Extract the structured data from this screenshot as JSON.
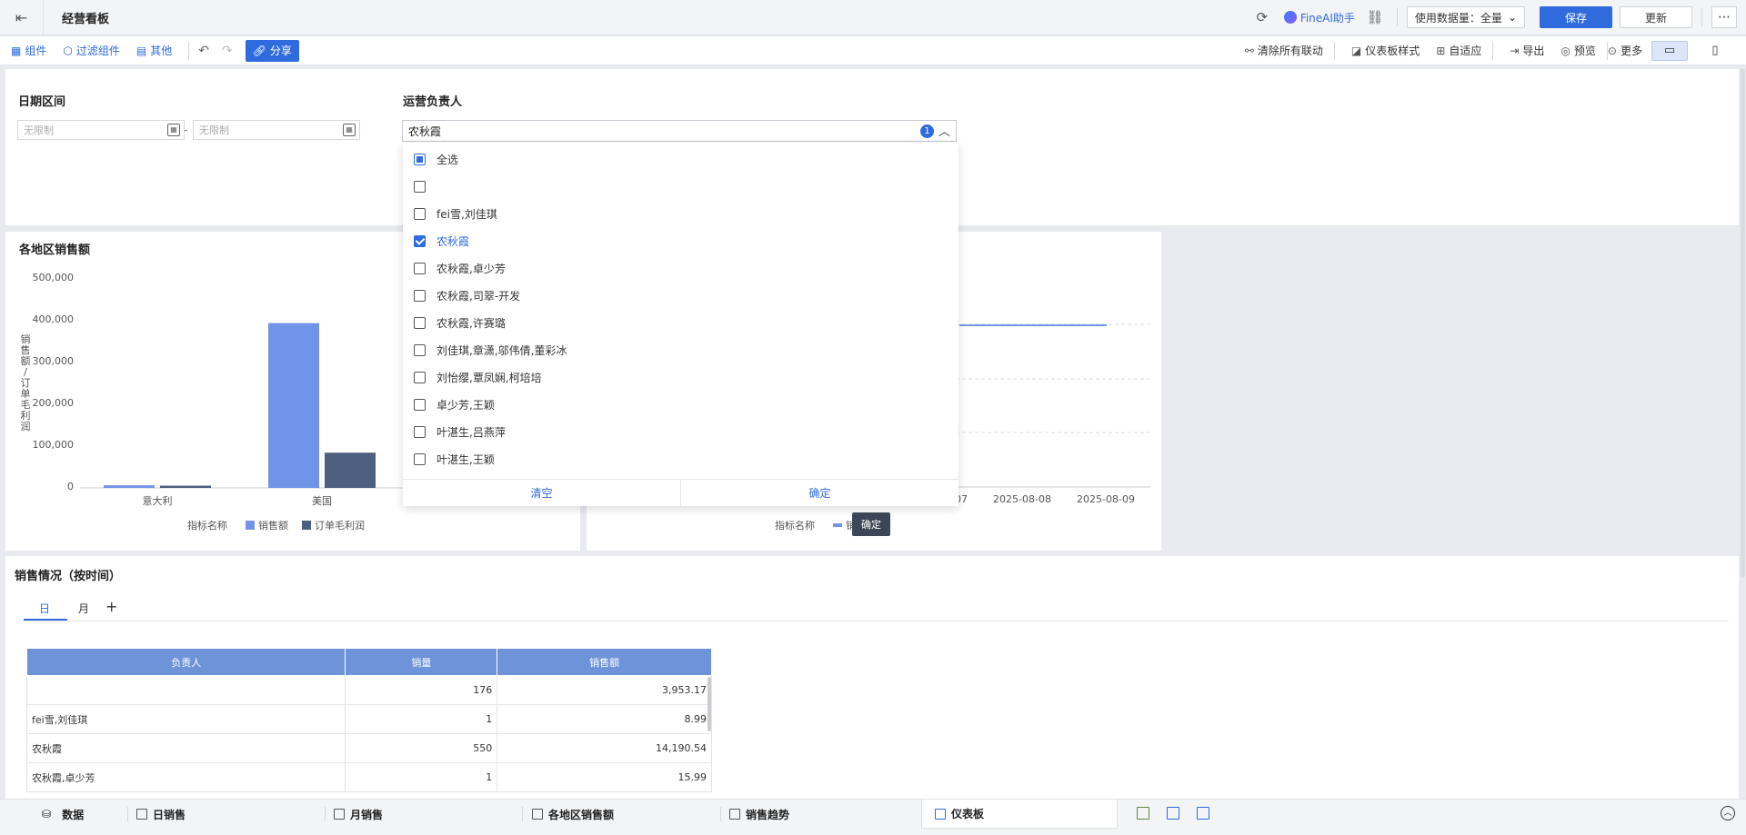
{
  "topbar": {
    "title": "经营看板",
    "fineai": "FineAI助手",
    "data_select": "使用数据量：全量",
    "save": "保存",
    "update": "更新"
  },
  "toolbar": {
    "component": "组件",
    "filter_component": "过滤组件",
    "other": "其他",
    "share": "分享",
    "clear_linkage": "清除所有联动",
    "dashboard_style": "仪表板样式",
    "adaptive": "自适应",
    "export": "导出",
    "preview": "预览",
    "more": "更多"
  },
  "filters": {
    "date_label": "日期区间",
    "date_start_placeholder": "无限制",
    "date_end_placeholder": "无限制",
    "date_sep": "-",
    "owner_label": "运营负责人",
    "owner_value": "农秋霞",
    "owner_count": "1",
    "options": [
      {
        "label": "全选",
        "state": "partial"
      },
      {
        "label": "",
        "state": "none"
      },
      {
        "label": "fei雪,刘佳琪",
        "state": "none"
      },
      {
        "label": "农秋霞",
        "state": "checked"
      },
      {
        "label": "农秋霞,卓少芳",
        "state": "none"
      },
      {
        "label": "农秋霞,司翠-开发",
        "state": "none"
      },
      {
        "label": "农秋霞,许赛璐",
        "state": "none"
      },
      {
        "label": "刘佳琪,章潇,邬伟倩,董彩冰",
        "state": "none"
      },
      {
        "label": "刘怡缨,覃凤娴,柯培培",
        "state": "none"
      },
      {
        "label": "卓少芳,王颖",
        "state": "none"
      },
      {
        "label": "叶湛生,吕燕萍",
        "state": "none"
      },
      {
        "label": "叶湛生,王颖",
        "state": "none"
      }
    ],
    "clear": "清空",
    "confirm": "确定",
    "tooltip": "确定"
  },
  "chart_data": [
    {
      "type": "bar",
      "title": "各地区销售额",
      "ylabel": "销售额/订单毛利润",
      "yticks": [
        "500,000",
        "400,000",
        "300,000",
        "200,000",
        "100,000",
        "0"
      ],
      "ylim": [
        0,
        500000
      ],
      "categories": [
        "意大利",
        "美国"
      ],
      "legend_title": "指标名称",
      "series": [
        {
          "name": "销售额",
          "color": "#7193e8",
          "values": [
            2000,
            390000
          ]
        },
        {
          "name": "订单毛利润",
          "color": "#4e5f80",
          "values": [
            1000,
            80000
          ]
        }
      ]
    },
    {
      "type": "line",
      "x_ticks": [
        "07",
        "2025-08-08",
        "2025-08-09"
      ],
      "legend_title": "指标名称",
      "series": [
        {
          "name": "销售额",
          "color": "#7193e8"
        }
      ]
    }
  ],
  "table": {
    "title": "销售情况（按时间）",
    "tabs": [
      "日",
      "月"
    ],
    "add": "+",
    "headers": [
      "负责人",
      "销量",
      "销售额"
    ],
    "rows": [
      [
        "",
        "176",
        "3,953.17"
      ],
      [
        "fei雪,刘佳琪",
        "1",
        "8.99"
      ],
      [
        "农秋霞",
        "550",
        "14,190.54"
      ],
      [
        "农秋霞,卓少芳",
        "1",
        "15.99"
      ]
    ]
  },
  "bottom_tabs": [
    "数据",
    "日销售",
    "月销售",
    "各地区销售额",
    "销售趋势",
    "仪表板"
  ]
}
